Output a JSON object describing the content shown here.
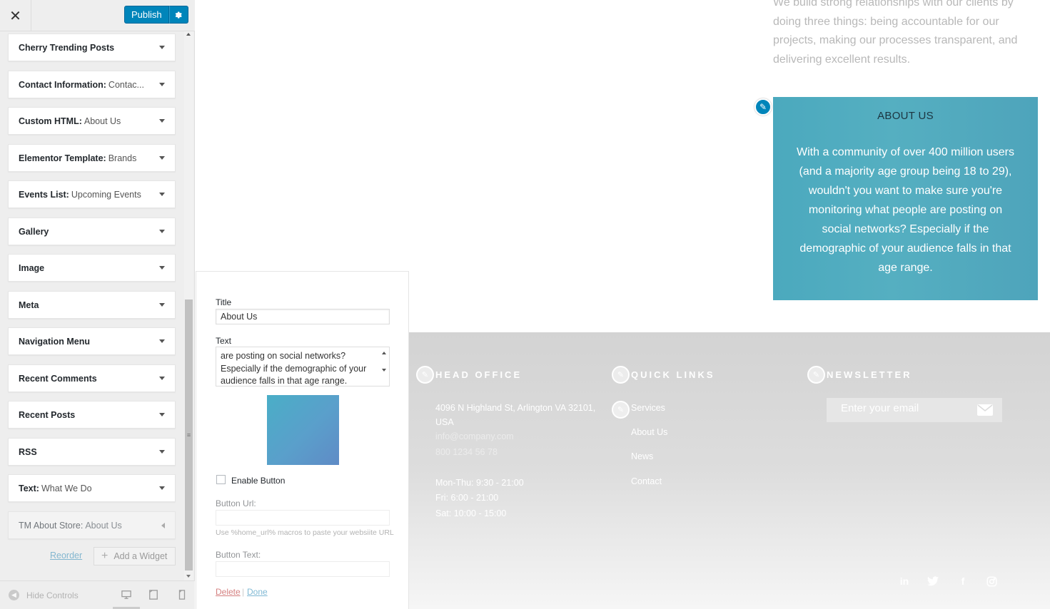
{
  "header": {
    "close_label": "✕",
    "publish_label": "Publish",
    "settings_icon": "gear-icon"
  },
  "widgets": [
    {
      "title": "Cherry Trending Posts",
      "sub": ""
    },
    {
      "title": "Contact Information:",
      "sub": "Contac..."
    },
    {
      "title": "Custom HTML:",
      "sub": "About Us"
    },
    {
      "title": "Elementor Template:",
      "sub": "Brands"
    },
    {
      "title": "Events List:",
      "sub": "Upcoming Events"
    },
    {
      "title": "Gallery",
      "sub": ""
    },
    {
      "title": "Image",
      "sub": ""
    },
    {
      "title": "Meta",
      "sub": ""
    },
    {
      "title": "Navigation Menu",
      "sub": ""
    },
    {
      "title": "Recent Comments",
      "sub": ""
    },
    {
      "title": "Recent Posts",
      "sub": ""
    },
    {
      "title": "RSS",
      "sub": ""
    },
    {
      "title": "Text:",
      "sub": "What We Do"
    },
    {
      "title": "TM About Store:",
      "sub": "About Us"
    }
  ],
  "actions": {
    "reorder_label": "Reorder",
    "add_widget_label": "Add a Widget"
  },
  "controls": {
    "hide_label": "Hide Controls"
  },
  "form": {
    "title_label": "Title",
    "title_value": "About Us",
    "text_label": "Text",
    "text_value": "are posting on social networks? Especially if the demographic of your audience falls in that age range.",
    "enable_button_label": "Enable Button",
    "button_url_label": "Button Url:",
    "button_url_hint": "Use %home_url% macros to paste your websiite URL",
    "button_text_label": "Button Text:",
    "delete_label": "Delete",
    "separator": "|",
    "done_label": "Done"
  },
  "preview": {
    "intro_text": "We build strong relationships with our clients by doing three things: being accountable for our projects, making our processes transparent, and delivering excellent results.",
    "about_title": "ABOUT US",
    "about_text": "With a community of over 400 million users (and a majority age group being 18 to 29), wouldn't you want to make sure you're monitoring what people are posting on social networks? Especially if the demographic of your audience falls in that age range.",
    "footer": {
      "head_office_title": "HEAD OFFICE",
      "address": "4096 N Highland St, Arlington VA 32101, USA",
      "email": "info@company.com",
      "phone": "800 1234 56 78",
      "hours_1": "Mon-Thu: 9:30 - 21:00",
      "hours_2": "Fri: 6:00 - 21:00",
      "hours_3": "Sat: 10:00 - 15:00",
      "quick_links_title": "QUICK LINKS",
      "links": [
        "Services",
        "About Us",
        "News",
        "Contact"
      ],
      "newsletter_title": "NEWSLETTER",
      "newsletter_placeholder": "Enter your email"
    }
  },
  "colors": {
    "primary": "#0085ba",
    "about_bg": "#4ba9be",
    "footer_bg": "#d3d3d3"
  }
}
